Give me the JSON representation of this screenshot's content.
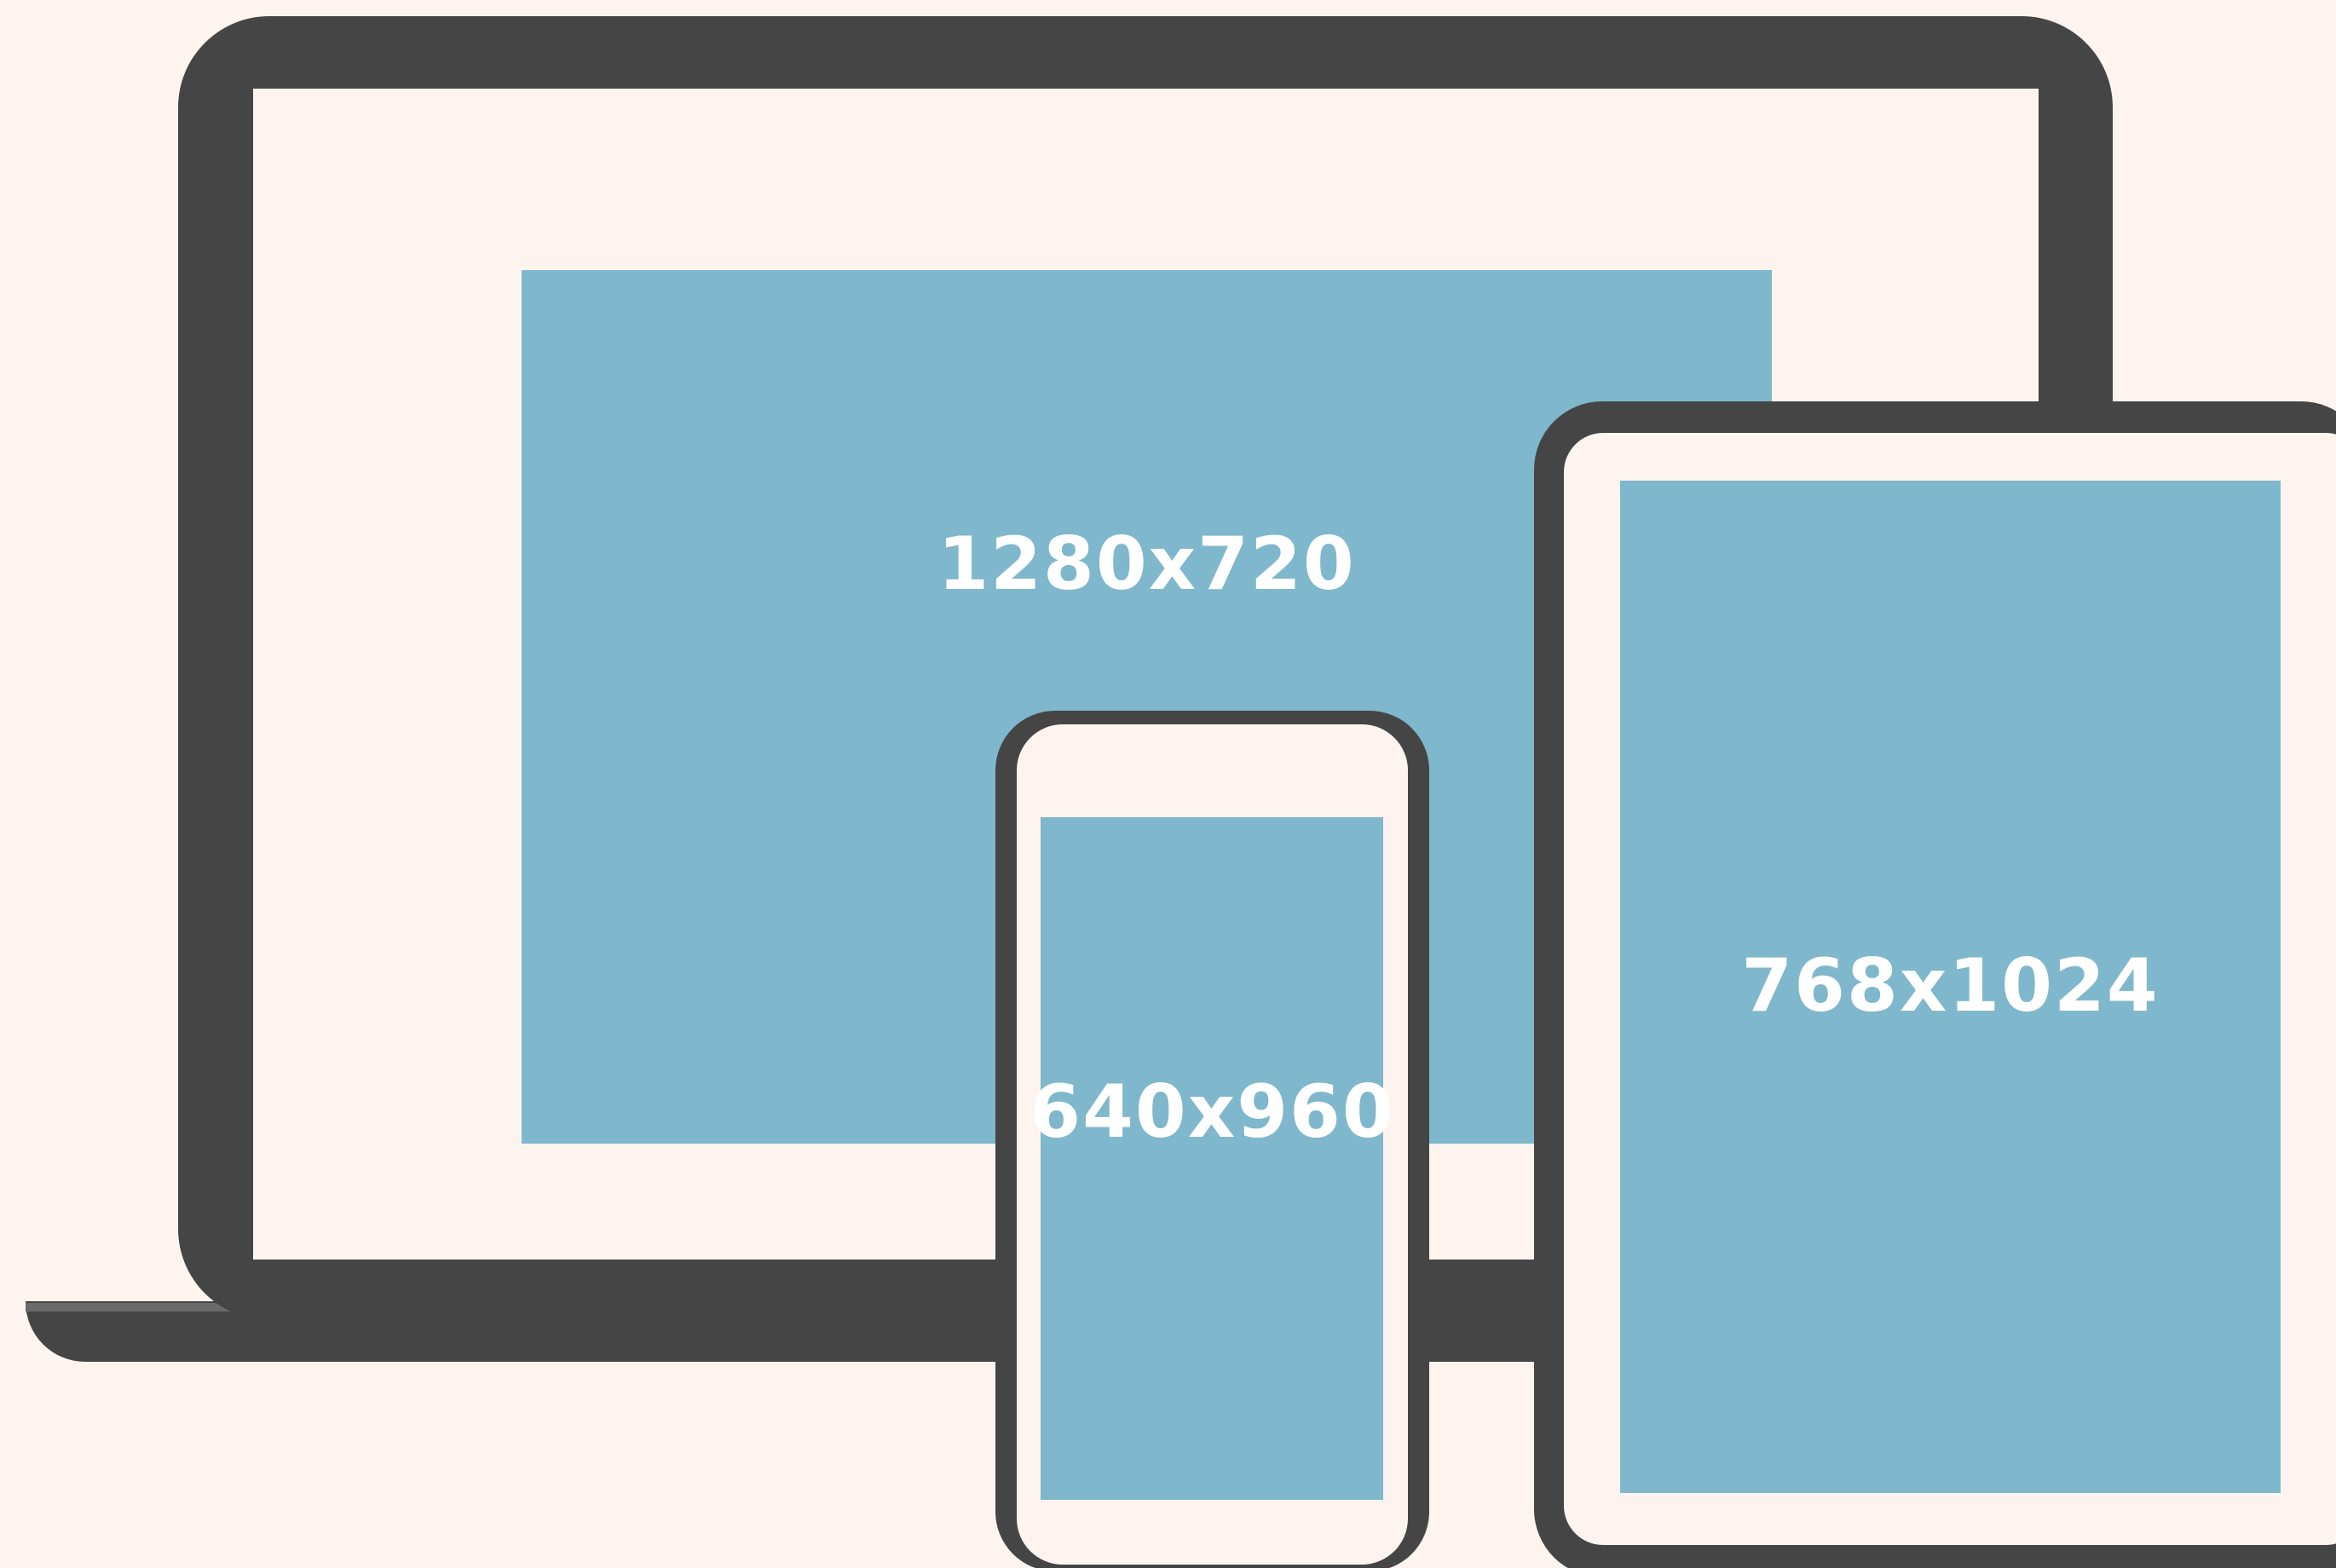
{
  "devices": {
    "laptop": {
      "resolution_label": "1280x720"
    },
    "phone": {
      "resolution_label": "640x960"
    },
    "tablet": {
      "resolution_label": "768x1024"
    }
  },
  "colors": {
    "background": "#fdf4f0",
    "device_frame": "#454545",
    "screen_fill": "#7fb7cc",
    "label_text": "#ffffff"
  }
}
